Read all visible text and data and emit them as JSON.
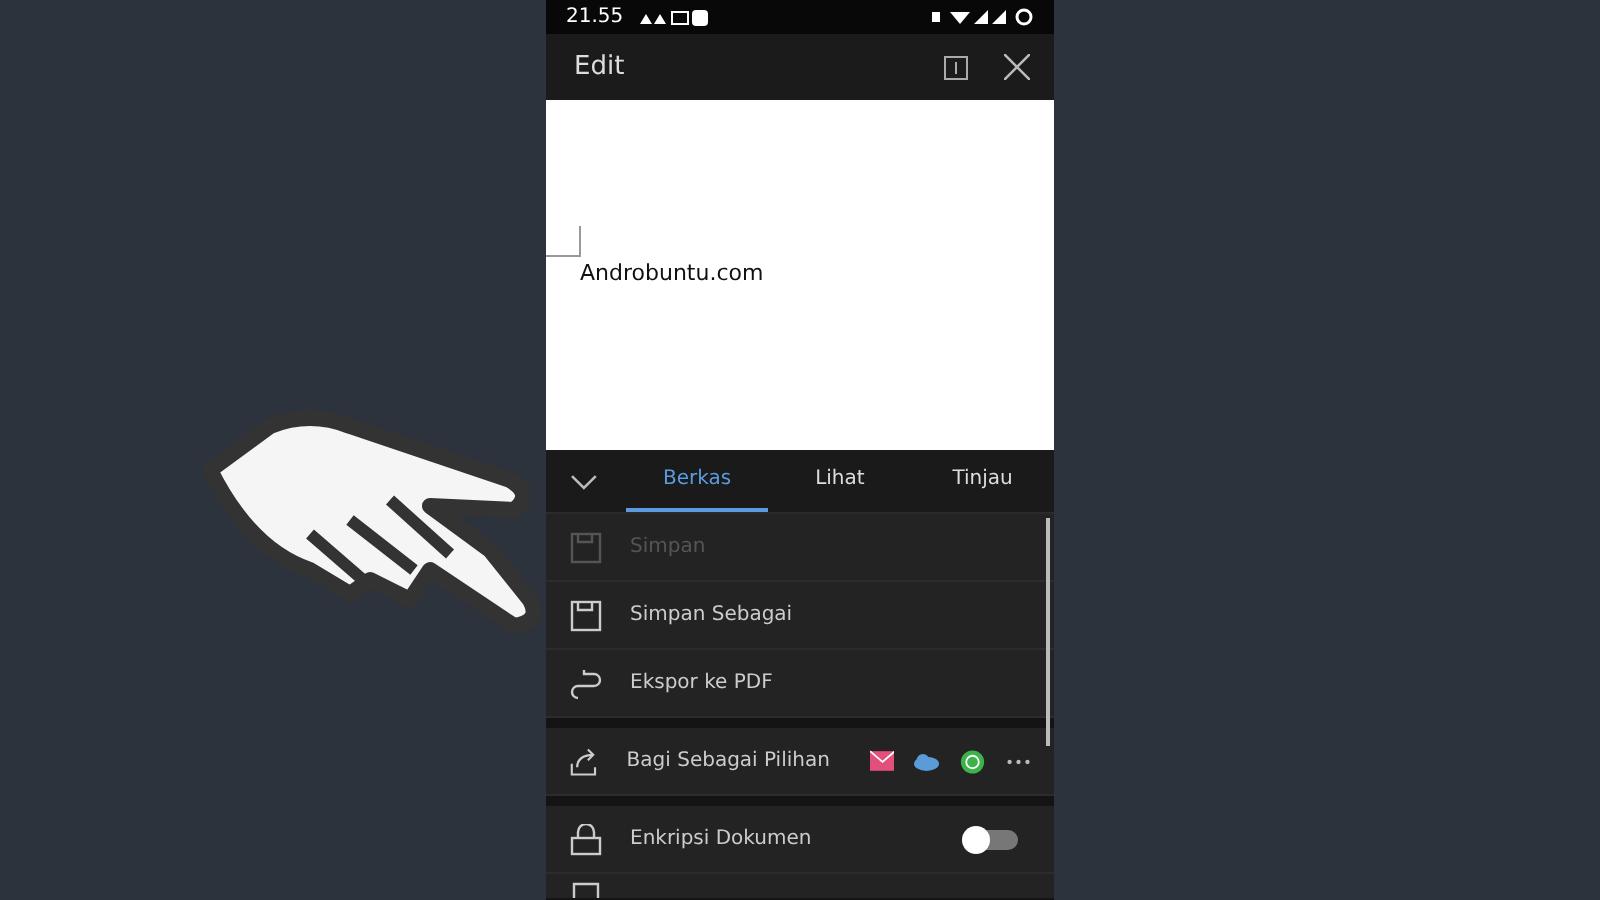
{
  "status_bar": {
    "time": "21.55"
  },
  "header": {
    "title": "Edit"
  },
  "document": {
    "text": "Androbuntu.com"
  },
  "tabs": [
    {
      "label": "Berkas",
      "selected": true
    },
    {
      "label": "Lihat",
      "selected": false
    },
    {
      "label": "Tinjau",
      "selected": false
    }
  ],
  "menu": [
    {
      "kind": "item",
      "label": "Simpan",
      "disabled": true
    },
    {
      "kind": "item",
      "label": "Simpan Sebagai",
      "disabled": false
    },
    {
      "kind": "item",
      "label": "Ekspor ke PDF",
      "disabled": false
    },
    {
      "kind": "share",
      "label": "Bagi Sebagai Pilihan",
      "disabled": false
    },
    {
      "kind": "toggle",
      "label": "Enkripsi Dokumen",
      "disabled": false,
      "on": false
    }
  ]
}
